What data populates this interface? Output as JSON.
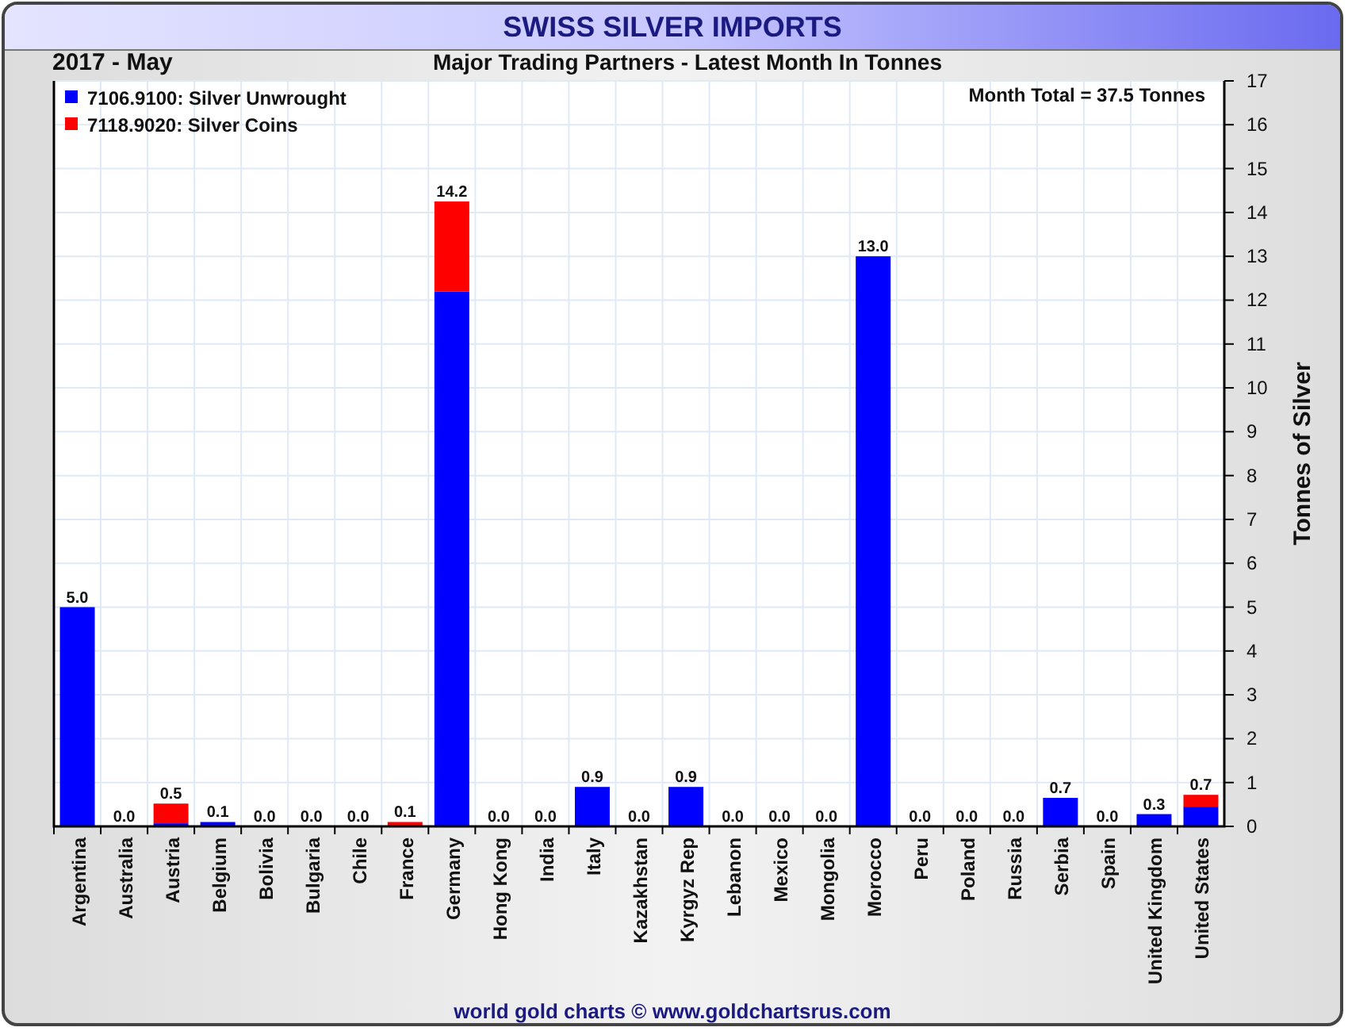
{
  "title": "SWISS SILVER IMPORTS",
  "period": "2017 - May",
  "subtitle": "Major Trading Partners - Latest Month In Tonnes",
  "month_total": "Month Total = 37.5 Tonnes",
  "footer": "world gold charts © www.goldchartsrus.com",
  "chart_data": {
    "type": "bar",
    "stacked": true,
    "grid": true,
    "legend": true,
    "orientation": "vertical",
    "ylabel": "Tonnes of Silver",
    "ylim": [
      0,
      17
    ],
    "yticks": [
      0,
      1,
      2,
      3,
      4,
      5,
      6,
      7,
      8,
      9,
      10,
      11,
      12,
      13,
      14,
      15,
      16,
      17
    ],
    "categories": [
      "Argentina",
      "Australia",
      "Austria",
      "Belgium",
      "Bolivia",
      "Bulgaria",
      "Chile",
      "France",
      "Germany",
      "Hong Kong",
      "India",
      "Italy",
      "Kazakhstan",
      "Kyrgyz Rep",
      "Lebanon",
      "Mexico",
      "Mongolia",
      "Morocco",
      "Peru",
      "Poland",
      "Russia",
      "Serbia",
      "Spain",
      "United Kingdom",
      "United States"
    ],
    "series": [
      {
        "name": "7106.9100: Silver Unwrought",
        "color": "#0000ff",
        "values": [
          5.0,
          0,
          0.07,
          0.1,
          0,
          0,
          0,
          0,
          12.2,
          0,
          0,
          0.9,
          0,
          0.9,
          0,
          0,
          0,
          13.0,
          0,
          0,
          0,
          0.65,
          0,
          0.28,
          0.45
        ]
      },
      {
        "name": "7118.9020: Silver Coins",
        "color": "#ff0000",
        "values": [
          0,
          null,
          0.45,
          0,
          0,
          0,
          0,
          0.1,
          2.05,
          0,
          0,
          0,
          0,
          0,
          0,
          0,
          0,
          0,
          0,
          0,
          0,
          0,
          0,
          0,
          0.27
        ]
      }
    ],
    "value_labels": [
      "5.0",
      "0.0",
      "0.5",
      "0.1",
      "0.0",
      "0.0",
      "0.0",
      "0.1",
      "14.2",
      "0.0",
      "0.0",
      "0.9",
      "0.0",
      "0.9",
      "0.0",
      "0.0",
      "0.0",
      "13.0",
      "0.0",
      "0.0",
      "0.0",
      "0.7",
      "0.0",
      "0.3",
      "0.7"
    ]
  }
}
